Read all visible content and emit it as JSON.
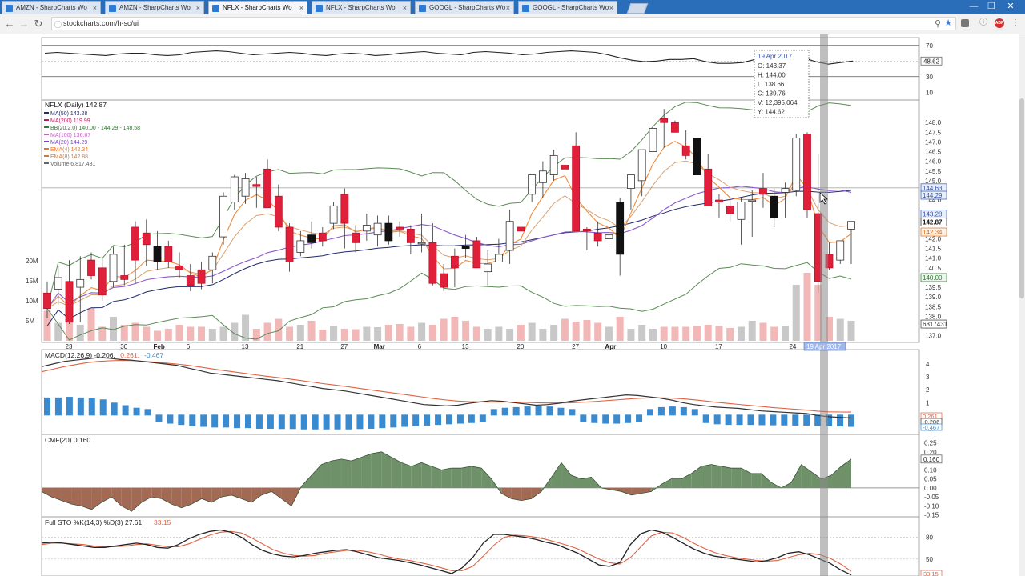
{
  "browser": {
    "tabs": [
      {
        "label": "AMZN - SharpCharts Wo",
        "active": false
      },
      {
        "label": "AMZN - SharpCharts Wo",
        "active": false
      },
      {
        "label": "NFLX - SharpCharts Wo",
        "active": true
      },
      {
        "label": "NFLX - SharpCharts Wo",
        "active": false
      },
      {
        "label": "GOOGL - SharpCharts Wo",
        "active": false
      },
      {
        "label": "GOOGL - SharpCharts Wo",
        "active": false
      }
    ],
    "tab_close": "×",
    "url": "stockcharts.com/h-sc/ui",
    "window_buttons": [
      "—",
      "❐",
      "✕"
    ],
    "toolbar_icons": [
      "search-icon",
      "star-icon",
      "extension-icon",
      "info-icon",
      "adblock-icon",
      "menu-icon"
    ],
    "adblock_label": "ABP"
  },
  "chart_data": [
    {
      "panel": "rsi",
      "type": "line",
      "yticks": [
        "70",
        "30",
        "10"
      ],
      "current_label": "48.62",
      "values": [
        60,
        61,
        60,
        59,
        58,
        57,
        59,
        60,
        60,
        58,
        57,
        58,
        61,
        62,
        63,
        62,
        60,
        58,
        59,
        60,
        61,
        60,
        58,
        57,
        59,
        60,
        59,
        57,
        58,
        60,
        61,
        62,
        60,
        59,
        58,
        61,
        62,
        61,
        60,
        58,
        59,
        61,
        62,
        63,
        62,
        61,
        58,
        54,
        51,
        49,
        50,
        52,
        52,
        53,
        49,
        47,
        47,
        48,
        52,
        55,
        60,
        58,
        54,
        49,
        46,
        48,
        50
      ]
    },
    {
      "panel": "price",
      "type": "candlestick",
      "title": "NFLX (Daily) 142.87",
      "legend": [
        {
          "text": "MA(50) 143.28",
          "color": "#1f2a6b"
        },
        {
          "text": "MA(200) 119.99",
          "color": "#c2185b"
        },
        {
          "text": "BB(20,2.0) 140.00 - 144.29 - 148.58",
          "color": "#2e7d32"
        },
        {
          "text": "MA(100) 136.67",
          "color": "#c060c0"
        },
        {
          "text": "MA(20) 144.29",
          "color": "#7b3fc6"
        },
        {
          "text": "EMA(4) 142.34",
          "color": "#e8742a"
        },
        {
          "text": "EMA(8) 142.88",
          "color": "#cc7a3c"
        },
        {
          "text": "Volume 6,817,431",
          "color": "#666666"
        }
      ],
      "ylim": [
        136.9,
        149.0
      ],
      "yticks": [
        "148.0",
        "147.5",
        "147.0",
        "146.5",
        "146.0",
        "145.5",
        "145.0",
        "144.0",
        "143.0",
        "142.0",
        "141.5",
        "141.0",
        "140.5",
        "140.0",
        "139.5",
        "139.0",
        "138.5",
        "138.0",
        "137.5",
        "137.0"
      ],
      "volume_ticks": [
        "20M",
        "15M",
        "10M",
        "5M"
      ],
      "x_dates": [
        "23",
        "30",
        "Feb",
        "6",
        "13",
        "21",
        "27",
        "Mar",
        "6",
        "13",
        "20",
        "27",
        "Apr",
        "10",
        "17",
        "24"
      ],
      "badges": [
        {
          "text": "144.63",
          "value": 144.63,
          "style": "blue"
        },
        {
          "text": "144.29",
          "value": 144.25,
          "style": "blue"
        },
        {
          "text": "143.28",
          "value": 143.28,
          "style": "blue"
        },
        {
          "text": "142.87",
          "value": 142.87,
          "style": "dark"
        },
        {
          "text": "142.34",
          "value": 142.35,
          "style": "orange"
        },
        {
          "text": "140.00",
          "value": 140.0,
          "style": "green"
        },
        {
          "text": "6817431",
          "value": 137.6,
          "style": "gray"
        }
      ],
      "horizontal_line": 144.63,
      "ohlc": [
        [
          139.2,
          139.8,
          137.9,
          138.4
        ],
        [
          139.4,
          140.6,
          138.6,
          140.0
        ],
        [
          139.8,
          140.9,
          137.6,
          137.7
        ],
        [
          139.5,
          141.1,
          137.7,
          139.9
        ],
        [
          140.9,
          141.3,
          139.9,
          140.1
        ],
        [
          140.5,
          141.0,
          138.8,
          139.1
        ],
        [
          139.8,
          141.6,
          139.5,
          141.2
        ],
        [
          140.1,
          141.7,
          139.6,
          139.9
        ],
        [
          142.6,
          142.9,
          139.7,
          140.9
        ],
        [
          142.3,
          143.0,
          140.6,
          141.7
        ],
        [
          141.6,
          142.4,
          140.4,
          140.8
        ],
        [
          141.6,
          141.9,
          140.5,
          140.8
        ],
        [
          140.6,
          141.3,
          140.0,
          140.4
        ],
        [
          140.1,
          140.7,
          139.3,
          139.6
        ],
        [
          140.4,
          140.8,
          139.4,
          139.7
        ],
        [
          140.4,
          141.3,
          139.7,
          141.1
        ],
        [
          142.1,
          144.4,
          141.7,
          144.2
        ],
        [
          143.9,
          145.3,
          143.5,
          145.2
        ],
        [
          144.2,
          145.4,
          143.8,
          145.1
        ],
        [
          144.8,
          145.2,
          143.6,
          144.7
        ],
        [
          145.6,
          146.1,
          143.7,
          143.6
        ],
        [
          144.2,
          144.8,
          142.4,
          142.6
        ],
        [
          142.6,
          142.8,
          140.3,
          140.8
        ],
        [
          141.3,
          142.4,
          141.1,
          141.9
        ],
        [
          142.2,
          142.9,
          141.5,
          141.8
        ],
        [
          142.3,
          142.6,
          141.6,
          141.9
        ],
        [
          142.8,
          143.9,
          142.5,
          143.7
        ],
        [
          144.3,
          144.6,
          141.5,
          142.8
        ],
        [
          142.3,
          142.7,
          141.3,
          141.8
        ],
        [
          142.4,
          143.3,
          141.9,
          142.7
        ],
        [
          142.2,
          143.2,
          141.6,
          142.8
        ],
        [
          142.8,
          143.2,
          141.7,
          141.9
        ],
        [
          142.6,
          142.9,
          142.1,
          142.5
        ],
        [
          142.5,
          142.7,
          141.2,
          141.8
        ],
        [
          141.8,
          143.3,
          141.3,
          141.8
        ],
        [
          141.8,
          142.8,
          139.6,
          139.7
        ],
        [
          140.2,
          140.7,
          139.3,
          139.5
        ],
        [
          141.1,
          141.5,
          139.5,
          140.5
        ],
        [
          141.6,
          142.2,
          141.0,
          141.5
        ],
        [
          141.9,
          142.1,
          140.6,
          140.5
        ],
        [
          140.3,
          141.4,
          139.6,
          140.7
        ],
        [
          140.8,
          142.0,
          141.0,
          141.2
        ],
        [
          141.4,
          143.5,
          140.7,
          142.9
        ],
        [
          142.6,
          143.0,
          142.1,
          142.4
        ],
        [
          144.3,
          144.8,
          143.9,
          145.3
        ],
        [
          144.9,
          146.0,
          144.1,
          145.5
        ],
        [
          145.3,
          146.6,
          145.0,
          146.3
        ],
        [
          145.8,
          146.2,
          144.7,
          145.6
        ],
        [
          146.8,
          147.5,
          142.5,
          142.4
        ],
        [
          142.5,
          142.6,
          141.4,
          142.4
        ],
        [
          142.3,
          142.9,
          141.6,
          141.9
        ],
        [
          142.0,
          142.4,
          141.7,
          142.2
        ],
        [
          143.9,
          144.1,
          140.1,
          141.2
        ],
        [
          144.6,
          145.3,
          143.5,
          145.3
        ],
        [
          145.0,
          146.5,
          144.2,
          146.6
        ],
        [
          146.5,
          147.2,
          145.6,
          147.7
        ],
        [
          148.2,
          148.7,
          146.7,
          148.0
        ],
        [
          148.0,
          148.1,
          147.8,
          147.5
        ],
        [
          146.8,
          147.6,
          146.1,
          146.3
        ],
        [
          147.2,
          147.1,
          145.9,
          145.3
        ],
        [
          145.6,
          146.4,
          143.7,
          143.7
        ],
        [
          144.0,
          144.3,
          143.1,
          143.9
        ],
        [
          143.7,
          144.0,
          142.9,
          143.3
        ],
        [
          143.0,
          144.1,
          141.7,
          143.9
        ],
        [
          144.0,
          144.5,
          142.1,
          144.0
        ],
        [
          144.6,
          145.4,
          143.6,
          144.3
        ],
        [
          144.2,
          144.6,
          142.6,
          143.1
        ],
        [
          144.4,
          144.9,
          143.1,
          144.6
        ],
        [
          144.5,
          147.4,
          144.2,
          147.2
        ],
        [
          147.4,
          147.5,
          143.1,
          143.5
        ],
        [
          143.3,
          146.4,
          139.2,
          139.8
        ],
        [
          141.2,
          141.8,
          140.4,
          140.5
        ],
        [
          140.9,
          141.6,
          140.7,
          141.9
        ],
        [
          142.5,
          142.9,
          140.7,
          142.9
        ]
      ],
      "volume": [
        7.5,
        4.5,
        5.5,
        4.0,
        8.2,
        3.5,
        6.0,
        4.0,
        4.5,
        3.5,
        2.5,
        3.0,
        4.0,
        3.5,
        3.5,
        3.0,
        3.5,
        4.5,
        6.5,
        3.0,
        4.5,
        5.5,
        3.5,
        4.0,
        5.0,
        2.8,
        3.8,
        3.0,
        2.9,
        3.5,
        3.4,
        4.0,
        4.2,
        3.5,
        4.5,
        4.0,
        5.5,
        6.0,
        5.0,
        3.5,
        3.0,
        3.5,
        3.0,
        4.0,
        4.5,
        3.0,
        4.0,
        5.5,
        4.8,
        5.2,
        4.5,
        3.5,
        6.0,
        3.0,
        4.0,
        3.0,
        3.5,
        3.5,
        3.5,
        3.8,
        4.0,
        3.8,
        3.2,
        3.5,
        5.0,
        4.5,
        3.5,
        3.8,
        14.0,
        17.0,
        14.0,
        6.0,
        5.5,
        5.0
      ],
      "tooltip": {
        "date": "19 Apr 2017",
        "lines": [
          "O: 143.37",
          "H: 144.00",
          "L: 138.66",
          "C: 139.76",
          "V: 12,395,064",
          "Y: 144.62"
        ]
      },
      "crosshair_label": "19 Apr 2017"
    },
    {
      "panel": "macd",
      "type": "line",
      "title": "MACD(12,26,9) -0.206,",
      "title_parts": [
        {
          "text": "MACD(12,26,9) -0.206,",
          "color": "#222222"
        },
        {
          "text": "0.261,",
          "color": "#e06040"
        },
        {
          "text": "-0.467",
          "color": "#3a8ad0"
        }
      ],
      "yticks": [
        "4",
        "3",
        "2",
        "1",
        "0",
        "-1"
      ],
      "ylim": [
        -1.1,
        4.5
      ],
      "badges": [
        "0.261",
        "-0.206",
        "-0.467"
      ],
      "macd": [
        3.8,
        4.0,
        4.2,
        4.3,
        4.4,
        4.5,
        4.45,
        4.35,
        4.3,
        4.2,
        4.1,
        4.0,
        3.9,
        3.7,
        3.5,
        3.3,
        3.2,
        3.1,
        3.0,
        2.9,
        2.8,
        2.7,
        2.55,
        2.4,
        2.25,
        2.1,
        2.0,
        1.9,
        1.75,
        1.6,
        1.45,
        1.3,
        1.15,
        1.0,
        0.85,
        0.8,
        0.75,
        0.8,
        0.95,
        1.05,
        1.15,
        1.1,
        1.0,
        0.9,
        0.8,
        0.85,
        0.95,
        1.1,
        1.2,
        1.3,
        1.4,
        1.5,
        1.6,
        1.55,
        1.45,
        1.35,
        1.2,
        1.0,
        0.85,
        0.75,
        0.65,
        0.6,
        0.55,
        0.45,
        0.35,
        0.3,
        0.25,
        0.2,
        0.15,
        0.0,
        -0.1,
        -0.15,
        -0.2
      ],
      "signal": [
        3.4,
        3.6,
        3.8,
        3.95,
        4.1,
        4.2,
        4.25,
        4.28,
        4.27,
        4.22,
        4.15,
        4.08,
        4.0,
        3.9,
        3.78,
        3.65,
        3.52,
        3.4,
        3.28,
        3.16,
        3.05,
        2.95,
        2.84,
        2.72,
        2.6,
        2.48,
        2.37,
        2.26,
        2.14,
        2.02,
        1.9,
        1.78,
        1.66,
        1.54,
        1.42,
        1.3,
        1.2,
        1.12,
        1.08,
        1.06,
        1.05,
        1.05,
        1.04,
        1.02,
        0.99,
        0.97,
        0.97,
        0.99,
        1.03,
        1.08,
        1.14,
        1.2,
        1.27,
        1.33,
        1.36,
        1.37,
        1.35,
        1.3,
        1.22,
        1.13,
        1.03,
        0.94,
        0.86,
        0.78,
        0.7,
        0.62,
        0.55,
        0.48,
        0.42,
        0.34,
        0.28,
        0.27,
        0.26
      ],
      "hist": [
        0.9,
        0.9,
        0.95,
        0.9,
        0.85,
        0.75,
        0.5,
        0.3,
        0.1,
        0.0,
        -0.1,
        -0.2,
        -0.3,
        -0.4,
        -0.45,
        -0.5,
        -0.5,
        -0.55,
        -0.55,
        -0.6,
        -0.6,
        -0.62,
        -0.62,
        -0.65,
        -0.65,
        -0.65,
        -0.65,
        -0.65,
        -0.62,
        -0.6,
        -0.55,
        -0.5,
        -0.45,
        -0.4,
        -0.35,
        -0.3,
        -0.25,
        -0.2,
        -0.15,
        -0.1,
        0.0,
        0.1,
        0.15,
        0.2,
        0.25,
        0.2,
        0.1,
        0.0,
        -0.1,
        -0.15,
        -0.2,
        -0.2,
        -0.15,
        -0.1,
        0.0,
        0.15,
        0.2,
        0.15,
        0.0,
        -0.15,
        -0.25,
        -0.3,
        -0.3,
        -0.3,
        -0.32,
        -0.33,
        -0.34,
        -0.35,
        -0.35,
        -0.38,
        -0.4,
        -0.42,
        -0.45
      ]
    },
    {
      "panel": "cmf",
      "type": "area",
      "title": "CMF(20) 0.160",
      "yticks": [
        "0.25",
        "0.20",
        "0.15",
        "0.10",
        "0.05",
        "0.00",
        "-0.05",
        "-0.10",
        "-0.15"
      ],
      "ylim": [
        -0.16,
        0.27
      ],
      "current_label": "0.160",
      "values": [
        -0.02,
        -0.05,
        -0.07,
        -0.09,
        -0.1,
        -0.12,
        -0.08,
        -0.05,
        -0.1,
        -0.13,
        -0.08,
        -0.05,
        -0.06,
        -0.09,
        -0.11,
        -0.09,
        -0.06,
        -0.08,
        -0.05,
        -0.04,
        -0.06,
        -0.08,
        -0.04,
        -0.02,
        -0.06,
        -0.1,
        0.01,
        0.07,
        0.13,
        0.15,
        0.16,
        0.15,
        0.17,
        0.19,
        0.2,
        0.17,
        0.14,
        0.12,
        0.14,
        0.12,
        0.1,
        0.11,
        0.11,
        0.12,
        0.11,
        0.05,
        -0.03,
        -0.06,
        -0.07,
        -0.06,
        -0.02,
        0.06,
        0.14,
        0.07,
        0.05,
        0.06,
        0.0,
        -0.01,
        -0.02,
        -0.04,
        -0.03,
        -0.02,
        0.02,
        0.05,
        0.05,
        0.08,
        0.12,
        0.13,
        0.12,
        0.11,
        0.11,
        0.08,
        0.08,
        0.03,
        0.0,
        0.03,
        0.13,
        0.09,
        0.05,
        0.07,
        0.12,
        0.16
      ]
    },
    {
      "panel": "sto",
      "type": "line",
      "title_parts": [
        {
          "text": "Full STO %K(14,3) %D(3) 27.61,",
          "color": "#222222"
        },
        {
          "text": "33.15",
          "color": "#e06040"
        }
      ],
      "yticks": [
        "80",
        "50"
      ],
      "ylim": [
        20,
        95
      ],
      "current_label": "33.15",
      "k": [
        72,
        73,
        72,
        70,
        68,
        66,
        66,
        68,
        70,
        72,
        70,
        66,
        65,
        70,
        78,
        84,
        88,
        90,
        87,
        80,
        70,
        62,
        57,
        54,
        53,
        55,
        58,
        60,
        62,
        63,
        60,
        56,
        52,
        50,
        48,
        45,
        42,
        38,
        34,
        30,
        38,
        52,
        72,
        84,
        84,
        82,
        80,
        77,
        73,
        70,
        64,
        58,
        50,
        42,
        40,
        45,
        70,
        85,
        90,
        87,
        80,
        72,
        64,
        58,
        54,
        52,
        50,
        48,
        46,
        48,
        52,
        58,
        60,
        56,
        50,
        44,
        35,
        28
      ],
      "d": [
        70,
        72,
        72,
        71,
        70,
        68,
        67,
        67,
        68,
        70,
        71,
        69,
        67,
        67,
        71,
        77,
        83,
        87,
        88,
        86,
        79,
        71,
        63,
        58,
        55,
        54,
        55,
        58,
        60,
        62,
        62,
        60,
        57,
        53,
        50,
        48,
        45,
        42,
        38,
        34,
        34,
        40,
        54,
        69,
        80,
        83,
        82,
        80,
        77,
        73,
        69,
        64,
        57,
        50,
        45,
        43,
        52,
        67,
        82,
        87,
        86,
        80,
        72,
        65,
        59,
        55,
        52,
        50,
        48,
        47,
        48,
        52,
        56,
        58,
        56,
        51,
        43,
        33
      ]
    }
  ]
}
